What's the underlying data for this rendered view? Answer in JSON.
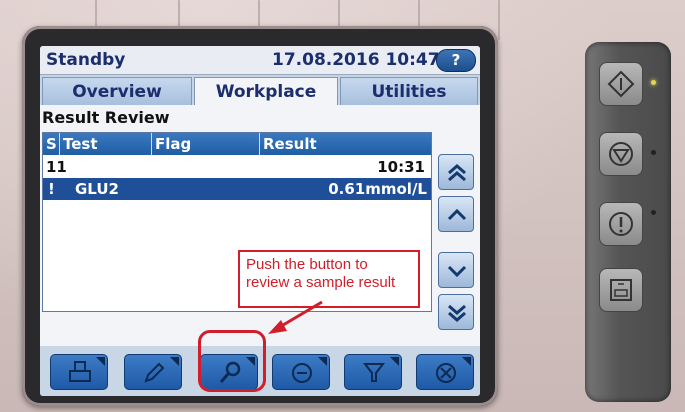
{
  "header": {
    "status": "Standby",
    "datetime": "17.08.2016 10:47",
    "help_label": "?"
  },
  "tabs": [
    {
      "label": "Overview",
      "active": false
    },
    {
      "label": "Workplace",
      "active": true
    },
    {
      "label": "Utilities",
      "active": false
    }
  ],
  "section_title": "Result Review",
  "list": {
    "columns": [
      "S",
      "Test",
      "Flag",
      "Result"
    ],
    "rows": [
      {
        "s": "11",
        "test": "",
        "flag": "",
        "result": "10:31"
      },
      {
        "s": "!",
        "test": "GLU2",
        "flag": "",
        "result": "0.61mmol/L",
        "selected": true
      }
    ]
  },
  "scroll_buttons": [
    {
      "icon": "double-chevron-up-icon"
    },
    {
      "icon": "chevron-up-icon"
    },
    {
      "icon": "chevron-down-icon"
    },
    {
      "icon": "double-chevron-down-icon"
    }
  ],
  "callout": {
    "line1": "Push the button to",
    "line2": "review a sample result",
    "color": "#d01f2a"
  },
  "toolbar": [
    {
      "icon": "print-icon"
    },
    {
      "icon": "pencil-icon"
    },
    {
      "icon": "magnifier-icon",
      "highlighted": true
    },
    {
      "icon": "minus-circle-icon"
    },
    {
      "icon": "filter-icon"
    },
    {
      "icon": "cancel-circle-icon"
    }
  ],
  "hardware_buttons": [
    {
      "icon": "start-diamond-icon",
      "led": "on"
    },
    {
      "icon": "stop-icon",
      "led": "off"
    },
    {
      "icon": "alarm-icon",
      "led": "off"
    },
    {
      "icon": "print-report-icon"
    }
  ],
  "colors": {
    "accent": "#1f5da5",
    "selected_row": "#1f4f99",
    "highlight": "#d01f2a"
  }
}
